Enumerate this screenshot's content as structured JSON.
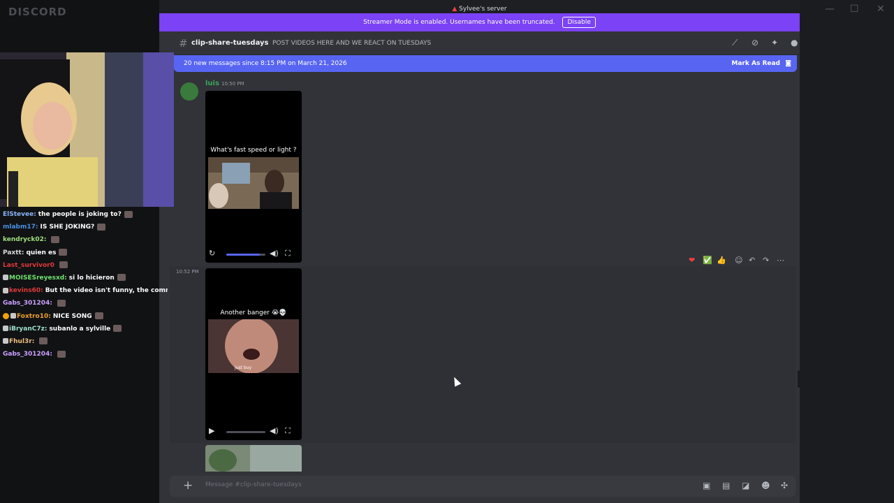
{
  "app": {
    "logo": "DISCORD",
    "server_name": "Sylvee's server"
  },
  "window_controls": {
    "minimize": "—",
    "maximize": "☐",
    "close": "✕"
  },
  "streamer_mode": {
    "message": "Streamer Mode is enabled. Usernames have been truncated.",
    "disable_label": "Disable"
  },
  "channel": {
    "name": "clip-share-tuesdays",
    "topic": "POST VIDEOS HERE AND WE REACT ON TUESDAYS"
  },
  "new_messages": {
    "text": "20 new messages since 8:15 PM on March 21, 2026",
    "mark_read": "Mark As Read"
  },
  "messages": [
    {
      "author": "luis",
      "time": "10:50 PM",
      "video": {
        "caption": "What's fast speed or light ?",
        "progress": 0.85
      }
    },
    {
      "time": "10:52 PM",
      "video": {
        "caption": "Another banger 😭💀",
        "subcaption": "just buy",
        "progress": 0.0
      }
    }
  ],
  "reactions": [
    "❤",
    "✅",
    "👍"
  ],
  "composer": {
    "placeholder": "Message #clip-share-tuesdays"
  },
  "twitch_chat": [
    {
      "user": "ElStevee:",
      "color": "#8ab4f8",
      "text": "the people is joking to?",
      "badges": 0
    },
    {
      "user": "mlabm17:",
      "color": "#4a90e2",
      "text": "IS SHE JOKING?",
      "badges": 0
    },
    {
      "user": "kendryck02:",
      "color": "#9ee07a",
      "text": "",
      "badges": 0
    },
    {
      "user": "Paxtt:",
      "color": "#d8d8d8",
      "text": "quien es",
      "badges": 0
    },
    {
      "user": "Last_survivor0",
      "color": "#e03a3a",
      "text": "",
      "badges": 0
    },
    {
      "user": "MOISESreyesxd:",
      "color": "#6fe36f",
      "text": "si lo hicieron",
      "badges": 1
    },
    {
      "user": "kevins60:",
      "color": "#e03a3a",
      "text": "But the video isn't funny, the commer",
      "badges": 1
    },
    {
      "user": "Gabs_301204:",
      "color": "#c9a0ff",
      "text": "",
      "badges": 0
    },
    {
      "user": "Foxtro10:",
      "color": "#f0a030",
      "text": "NICE SONG",
      "badges": 2
    },
    {
      "user": "iBryanC7z:",
      "color": "#9ee0c8",
      "text": "subanlo a sylville",
      "badges": 1
    },
    {
      "user": "Fhul3r:",
      "color": "#f0c080",
      "text": "",
      "badges": 1
    },
    {
      "user": "Gabs_301204:",
      "color": "#c9a0ff",
      "text": "",
      "badges": 0
    }
  ]
}
